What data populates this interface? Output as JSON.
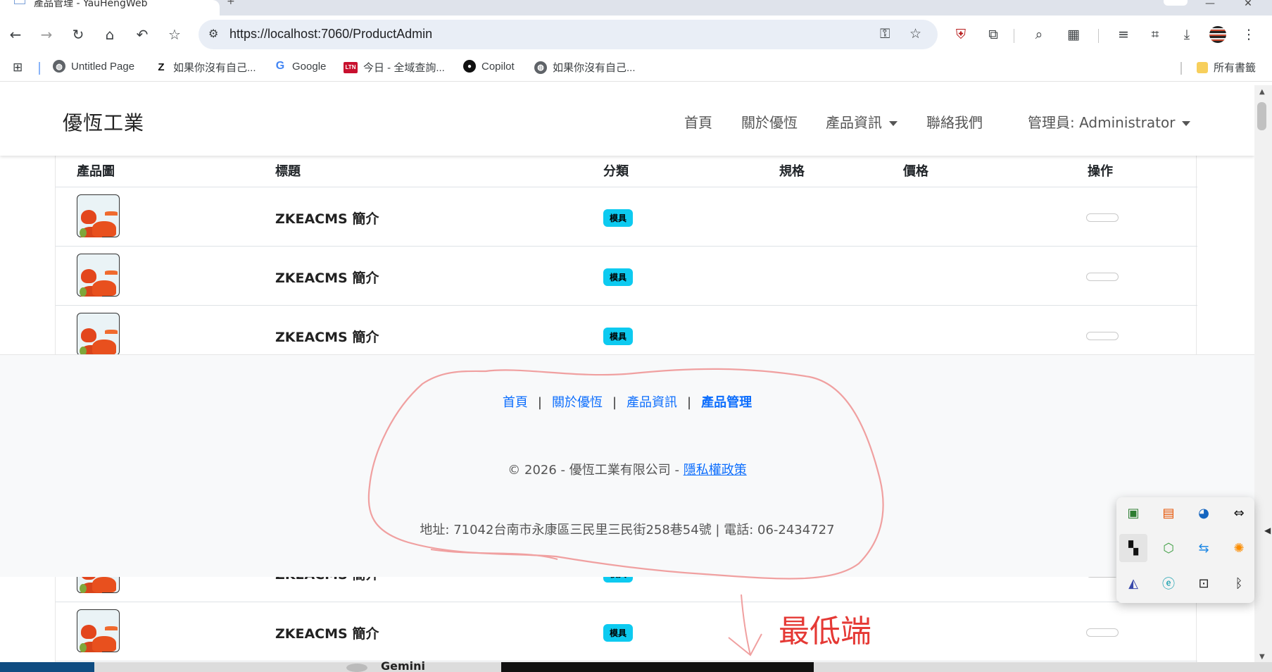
{
  "browser": {
    "tab_title": "產品管理 - YauHengWeb",
    "url": "https://localhost:7060/ProductAdmin",
    "bookmarks": [
      {
        "label": "Untitled Page",
        "icon": "globe-icon"
      },
      {
        "label": "如果你沒有自己...",
        "icon": "z-icon"
      },
      {
        "label": "Google",
        "icon": "google-icon"
      },
      {
        "label": "今日 - 全域查詢...",
        "icon": "ltn-icon"
      },
      {
        "label": "Copilot",
        "icon": "github-icon"
      },
      {
        "label": "如果你沒有自己...",
        "icon": "globe-icon"
      }
    ],
    "all_bookmarks_label": "所有書籤"
  },
  "navbar": {
    "brand": "優恆工業",
    "links": [
      "首頁",
      "關於優恆",
      "產品資訊",
      "聯絡我們"
    ],
    "admin_label": "管理員: Administrator"
  },
  "table": {
    "headers": [
      "產品圖",
      "標題",
      "分類",
      "規格",
      "價格",
      "操作"
    ],
    "rows": [
      {
        "title": "ZKEACMS 簡介",
        "category": "模具"
      },
      {
        "title": "ZKEACMS 簡介",
        "category": "模具"
      },
      {
        "title": "ZKEACMS 簡介",
        "category": "模具"
      },
      {
        "title": "ZKEACMS 簡介",
        "category": "模具"
      },
      {
        "title": "ZKEACMS 簡介",
        "category": "模具"
      }
    ]
  },
  "footer": {
    "links": [
      "首頁",
      "關於優恆",
      "產品資訊",
      "產品管理"
    ],
    "copyright": "© 2026 - 優恆工業有限公司 - ",
    "privacy": "隱私權政策",
    "address": "地址: 71042台南市永康區三民里三民街258巷54號 | 電話: 06-2434727"
  },
  "annotation": {
    "note": "最低端",
    "color": "#e53935"
  },
  "taskbar": {
    "app_label": "Gemini"
  },
  "colors": {
    "link": "#0d6efd",
    "badge": "#0dcaf0",
    "annotation_loop": "#f0a0a0"
  }
}
